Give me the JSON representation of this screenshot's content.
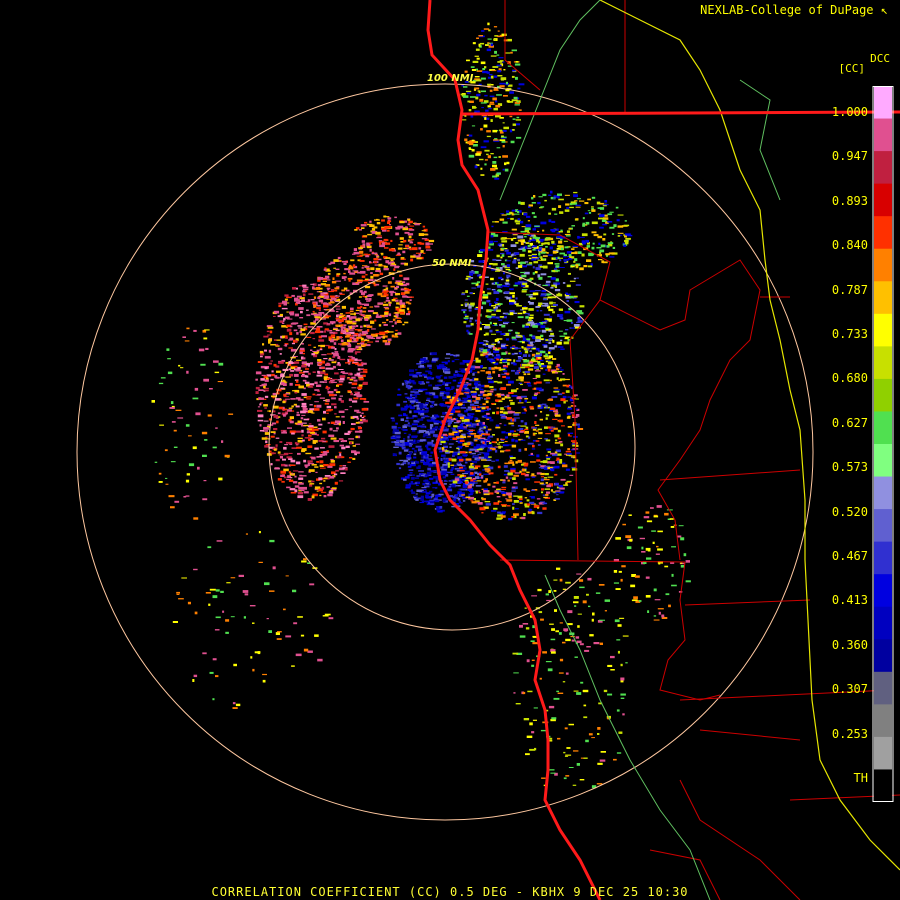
{
  "credit": "NEXLAB-College of DuPage",
  "credit_icon": "cursor-arrow-icon",
  "legend": {
    "title_right": "DCC",
    "title_left": "[CC]",
    "ticks": [
      "1.000",
      "0.947",
      "0.893",
      "0.840",
      "0.787",
      "0.733",
      "0.680",
      "0.627",
      "0.573",
      "0.520",
      "0.467",
      "0.413",
      "0.360",
      "0.307",
      "0.253",
      "TH"
    ],
    "colors_top_to_bottom": [
      "#ffaaff",
      "#e05090",
      "#c02040",
      "#d80000",
      "#ff3000",
      "#ff8000",
      "#ffc000",
      "#ffff00",
      "#c8e000",
      "#90d000",
      "#50e050",
      "#80ff80",
      "#9090e0",
      "#6060d0",
      "#3030d0",
      "#0000e0",
      "#0000c0",
      "#0000a0",
      "#606080",
      "#808080",
      "#a0a0a0",
      "#000000"
    ]
  },
  "rings": [
    {
      "label": "100 NMI"
    },
    {
      "label": "50 NMI"
    }
  ],
  "footer": "CORRELATION COEFFICIENT (CC) 0.5 DEG - KBHX 9 DEC 25 10:30",
  "colors": {
    "coastline": "#ff0000",
    "state_border": "#ffff00",
    "county_border": "#cc0000",
    "ring": "#ffc8a0",
    "label": "#ffff00"
  }
}
